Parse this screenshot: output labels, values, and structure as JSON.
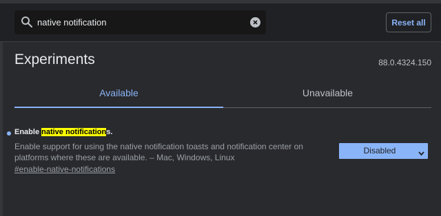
{
  "search": {
    "value": "native notification",
    "icon": "search-icon",
    "clear_icon": "clear-icon"
  },
  "header": {
    "reset_label": "Reset all"
  },
  "page": {
    "title": "Experiments",
    "version": "88.0.4324.150"
  },
  "tabs": [
    {
      "label": "Available",
      "selected": true
    },
    {
      "label": "Unavailable",
      "selected": false
    }
  ],
  "experiment": {
    "name_prefix": "Enable ",
    "name_highlight": "native notification",
    "name_suffix": "s.",
    "description": "Enable support for using the native notification toasts and notification center on platforms where these are available. – Mac, Windows, Linux",
    "link": "#enable-native-notifications",
    "select_value": "Disabled"
  },
  "colors": {
    "accent": "#8ab4f8",
    "background": "#292a2d",
    "highlight": "#ffff00"
  }
}
